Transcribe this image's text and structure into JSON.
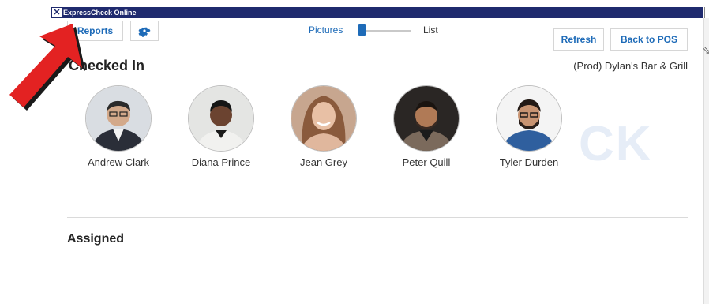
{
  "window": {
    "title": "ExpressCheck Online"
  },
  "toolbar": {
    "reports_label": "Reports",
    "gear_icon": "gear-icon",
    "view_toggle": {
      "left": "Pictures",
      "right": "List",
      "selected": "Pictures"
    },
    "refresh_label": "Refresh",
    "back_label": "Back to POS"
  },
  "checked_in": {
    "title": "Checked In",
    "location": "(Prod) Dylan's Bar & Grill",
    "people": [
      {
        "name": "Andrew Clark"
      },
      {
        "name": "Diana Prince"
      },
      {
        "name": "Jean Grey"
      },
      {
        "name": "Peter Quill"
      },
      {
        "name": "Tyler Durden"
      }
    ],
    "watermark": "CK"
  },
  "assigned": {
    "title": "Assigned"
  },
  "colors": {
    "accent": "#1e6bb8",
    "titlebar": "#1f2a6e",
    "arrow": "#e32222"
  }
}
